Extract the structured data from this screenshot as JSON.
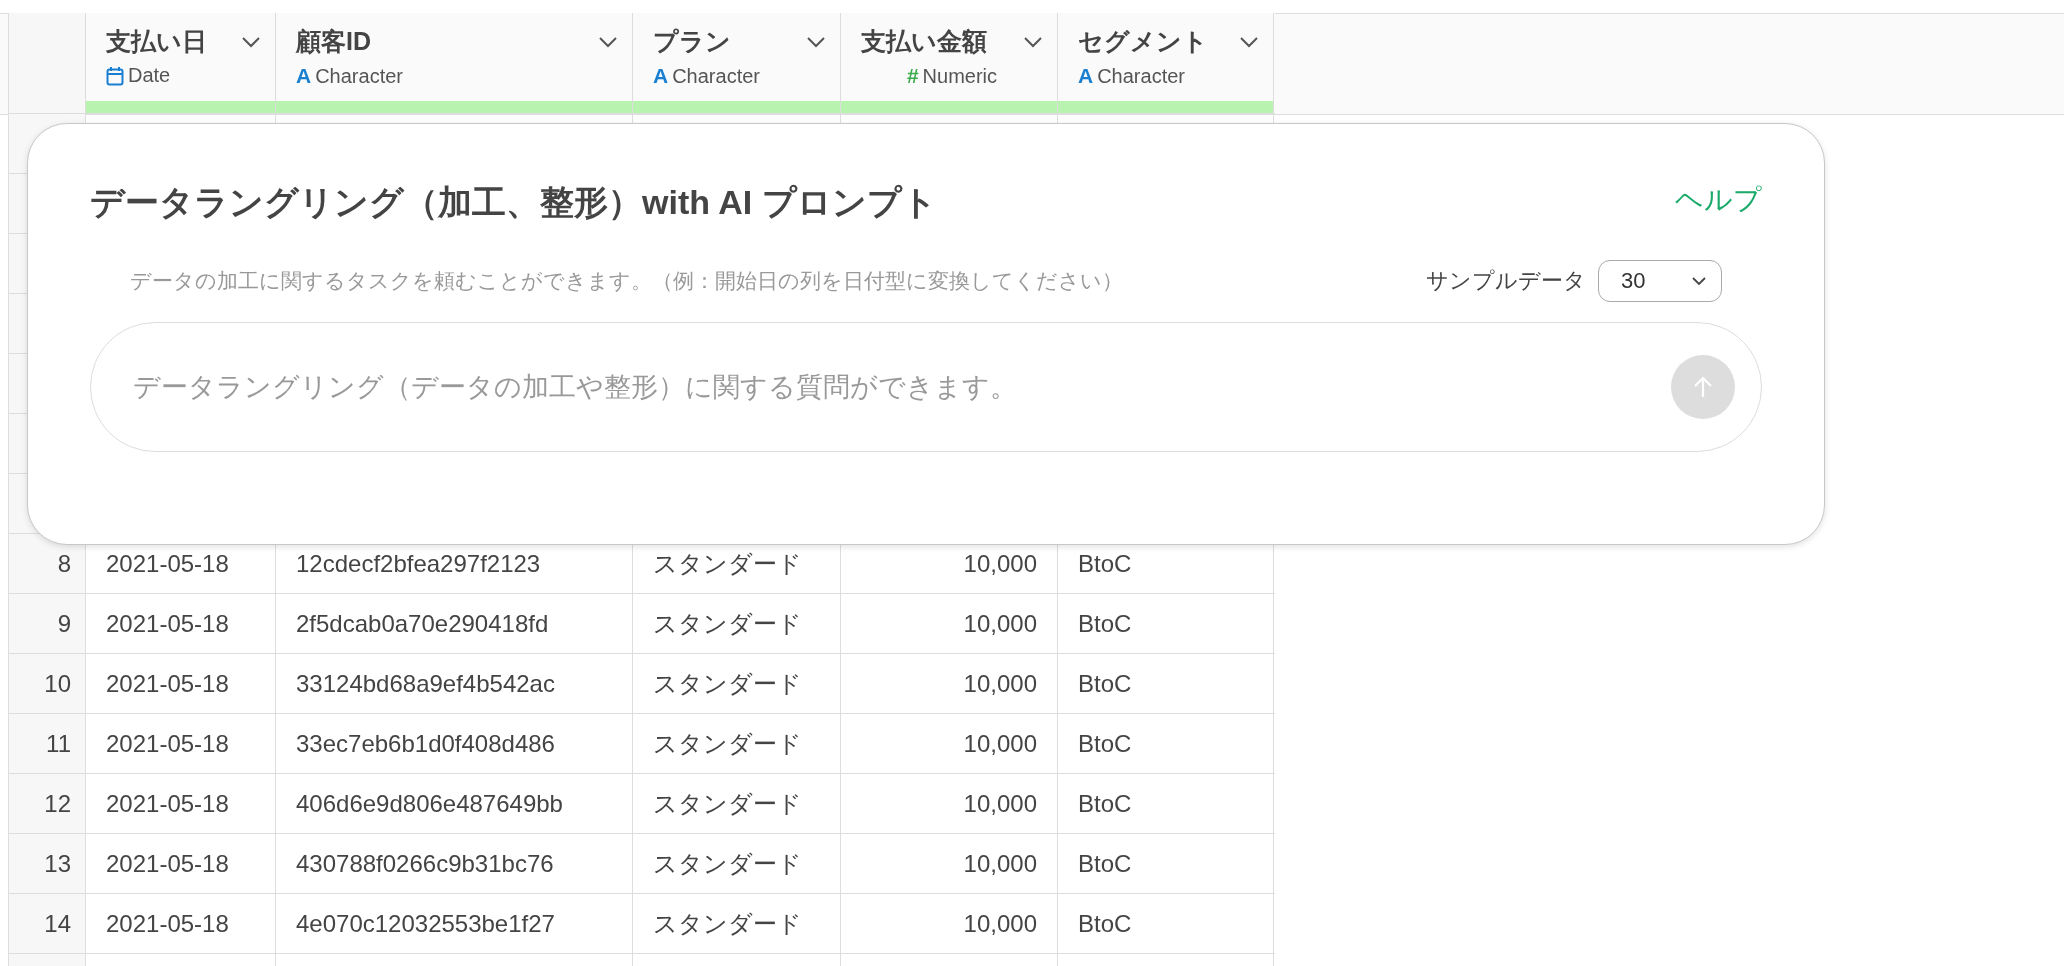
{
  "table": {
    "columns": [
      {
        "label": "支払い日",
        "type": "Date",
        "kind": "date"
      },
      {
        "label": "顧客ID",
        "type": "Character",
        "kind": "character",
        "type_icon": "A"
      },
      {
        "label": "プラン",
        "type": "Character",
        "kind": "character",
        "type_icon": "A"
      },
      {
        "label": "支払い金額",
        "type": "Numeric",
        "kind": "numeric",
        "type_icon": "#"
      },
      {
        "label": "セグメント",
        "type": "Character",
        "kind": "character",
        "type_icon": "A"
      }
    ],
    "rows": [
      {
        "number": "8",
        "cells": [
          "2021-05-18",
          "12cdecf2bfea297f2123",
          "スタンダード",
          "10,000",
          "BtoC"
        ]
      },
      {
        "number": "9",
        "cells": [
          "2021-05-18",
          "2f5dcab0a70e290418fd",
          "スタンダード",
          "10,000",
          "BtoC"
        ]
      },
      {
        "number": "10",
        "cells": [
          "2021-05-18",
          "33124bd68a9ef4b542ac",
          "スタンダード",
          "10,000",
          "BtoC"
        ]
      },
      {
        "number": "11",
        "cells": [
          "2021-05-18",
          "33ec7eb6b1d0f408d486",
          "スタンダード",
          "10,000",
          "BtoC"
        ]
      },
      {
        "number": "12",
        "cells": [
          "2021-05-18",
          "406d6e9d806e487649bb",
          "スタンダード",
          "10,000",
          "BtoC"
        ]
      },
      {
        "number": "13",
        "cells": [
          "2021-05-18",
          "430788f0266c9b31bc76",
          "スタンダード",
          "10,000",
          "BtoC"
        ]
      },
      {
        "number": "14",
        "cells": [
          "2021-05-18",
          "4e070c12032553be1f27",
          "スタンダード",
          "10,000",
          "BtoC"
        ]
      }
    ]
  },
  "dialog": {
    "title": "データラングリング（加工、整形）with AI プロンプト",
    "help_link": "ヘルプ",
    "description": "データの加工に関するタスクを頼むことができます。（例：開始日の列を日付型に変換してください）",
    "sample_label": "サンプルデータ",
    "sample_value": "30",
    "prompt": {
      "placeholder": "データラングリング（データの加工や整形）に関する質問ができます。"
    }
  }
}
